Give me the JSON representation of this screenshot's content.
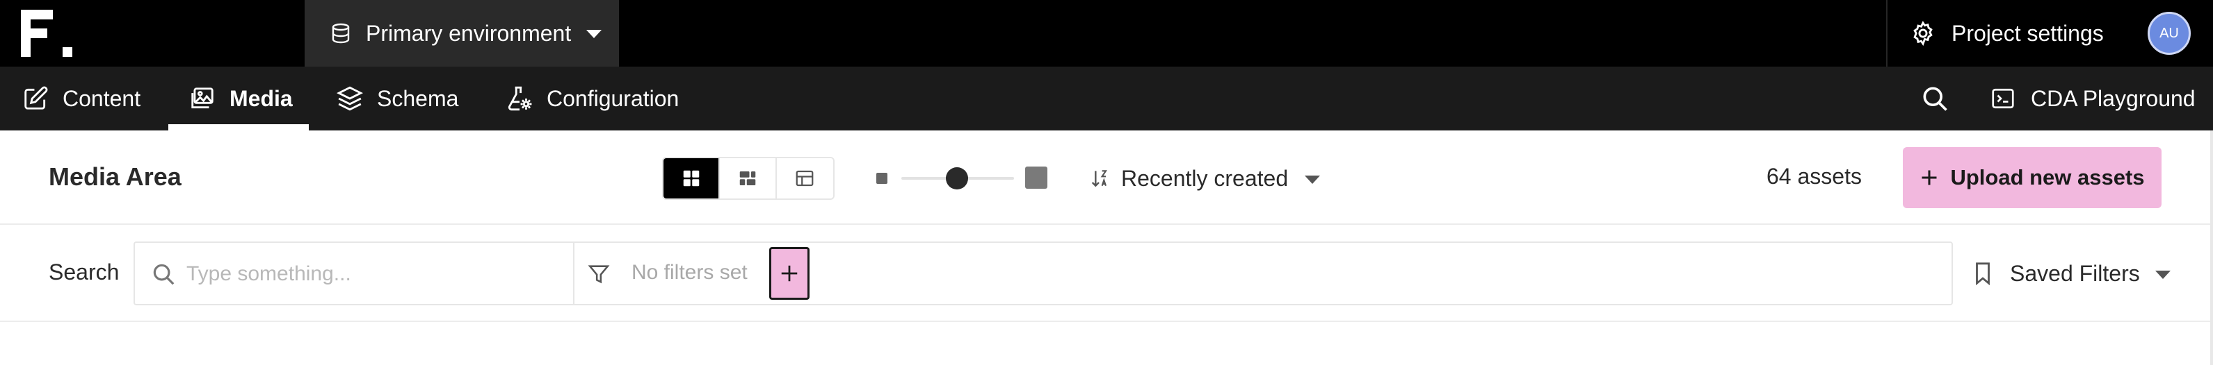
{
  "topbar": {
    "environment": "Primary environment",
    "project_settings": "Project settings",
    "avatar_initials": "AU"
  },
  "nav": {
    "items": [
      {
        "label": "Content",
        "icon": "edit-icon",
        "active": false
      },
      {
        "label": "Media",
        "icon": "image-icon",
        "active": true
      },
      {
        "label": "Schema",
        "icon": "layers-icon",
        "active": false
      },
      {
        "label": "Configuration",
        "icon": "flask-gear-icon",
        "active": false
      }
    ],
    "cda_playground": "CDA Playground"
  },
  "toolbar": {
    "title": "Media Area",
    "view_modes": [
      "grid",
      "masonry",
      "table"
    ],
    "active_view": "grid",
    "sort": "Recently created",
    "asset_count": "64 assets",
    "upload_label": "Upload new assets"
  },
  "filters": {
    "search_label": "Search",
    "search_placeholder": "Type something...",
    "no_filters": "No filters set",
    "saved_filters": "Saved Filters"
  },
  "colors": {
    "accent": "#f2b8de",
    "topbar_bg": "#000000",
    "navbar_bg": "#1b1b1b",
    "avatar_bg": "#6b8be0"
  }
}
